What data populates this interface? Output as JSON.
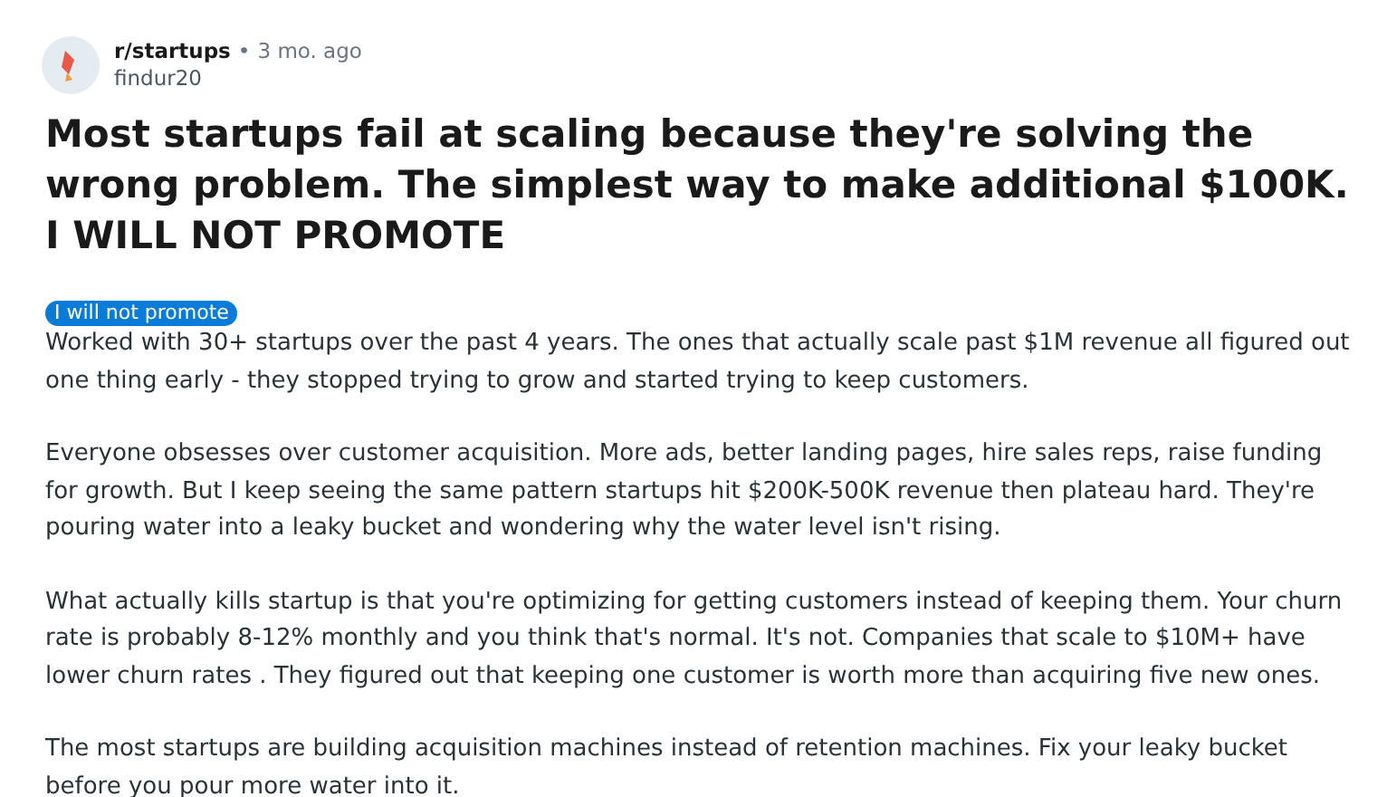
{
  "post": {
    "subreddit": "r/startups",
    "separator": "•",
    "time": "3 mo. ago",
    "author": "findur20",
    "title": "Most startups fail at scaling because they're solving the wrong problem. The simplest way to make additional $100K. I WILL NOT PROMOTE",
    "flair": {
      "label": "I will not promote",
      "color": "#0a7bd6"
    },
    "paragraphs": [
      "Worked with 30+ startups over the past 4 years. The ones that actually scale past $1M revenue all figured out one thing early - they stopped trying to grow and started trying to keep customers.",
      "Everyone obsesses over customer acquisition. More ads, better landing pages, hire sales reps, raise funding for growth. But I keep seeing the same pattern startups hit $200K-500K revenue then plateau hard. They're pouring water into a leaky bucket and wondering why the water level isn't rising.",
      "What actually kills startup is that you're optimizing for getting customers instead of keeping them. Your churn rate is probably 8-12% monthly and you think that's normal. It's not. Companies that scale to $10M+ have lower churn rates . They figured out that keeping one customer is worth more than acquiring five new ones.",
      "The most startups are building acquisition machines instead of retention machines. Fix your leaky bucket before you pour more water into it."
    ]
  }
}
